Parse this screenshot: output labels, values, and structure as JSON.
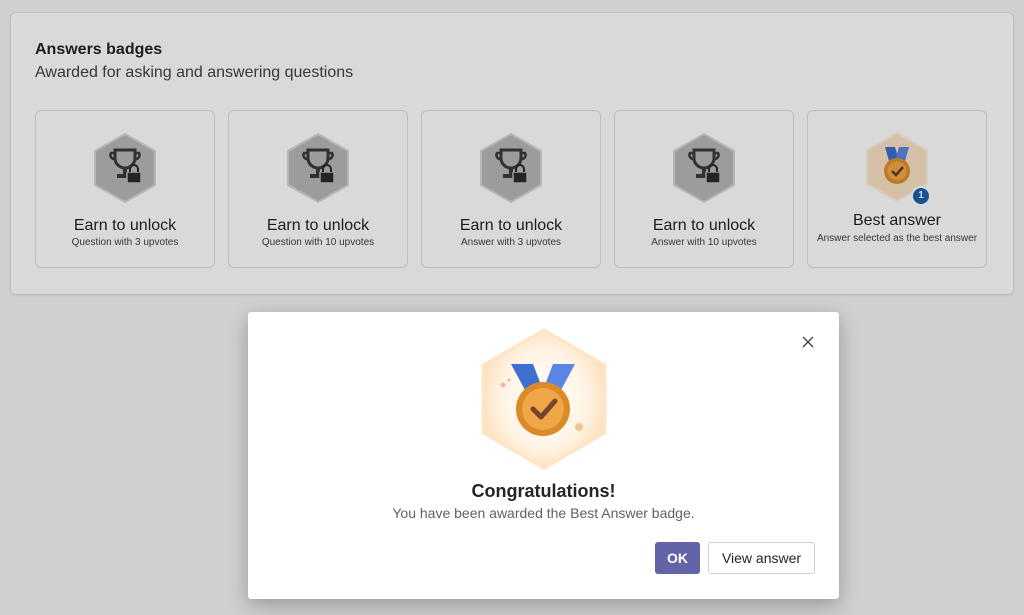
{
  "section": {
    "title": "Answers badges",
    "subtitle": "Awarded for asking and answering questions"
  },
  "badges": [
    {
      "title": "Earn to unlock",
      "description": "Question with 3 upvotes",
      "icon": "locked-trophy-icon",
      "locked": true
    },
    {
      "title": "Earn to unlock",
      "description": "Question with 10 upvotes",
      "icon": "locked-trophy-icon",
      "locked": true
    },
    {
      "title": "Earn to unlock",
      "description": "Answer with 3 upvotes",
      "icon": "locked-trophy-icon",
      "locked": true
    },
    {
      "title": "Earn to unlock",
      "description": "Answer with 10 upvotes",
      "icon": "locked-trophy-icon",
      "locked": true
    },
    {
      "title": "Best answer",
      "description": "Answer selected as the best answer",
      "icon": "best-answer-medal-icon",
      "locked": false,
      "count": "1"
    }
  ],
  "dialog": {
    "title": "Congratulations!",
    "message": "You have been awarded the Best Answer badge.",
    "ok_label": "OK",
    "view_label": "View answer",
    "close_icon": "close-icon",
    "medal_icon": "best-answer-medal-icon"
  },
  "colors": {
    "primary": "#6264a7",
    "count_badge": "#1f5fae",
    "medal_ribbon": "#4a78d6",
    "medal_gold": "#e29a3c",
    "locked_hex": "#bdbdbd"
  }
}
